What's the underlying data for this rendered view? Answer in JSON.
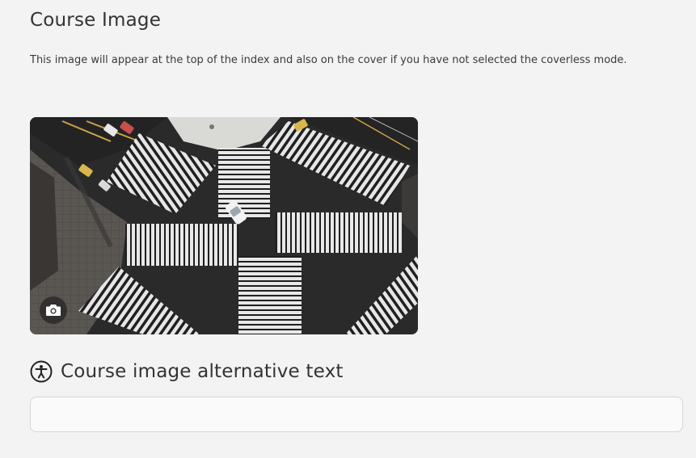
{
  "course_image": {
    "title": "Course Image",
    "description": "This image will appear at the top of the index and also on the cover if you have not selected the coverless mode.",
    "image_alt_icon": "camera-icon"
  },
  "alt_text": {
    "title": "Course image alternative text",
    "icon": "accessibility-icon",
    "value": "",
    "placeholder": ""
  }
}
